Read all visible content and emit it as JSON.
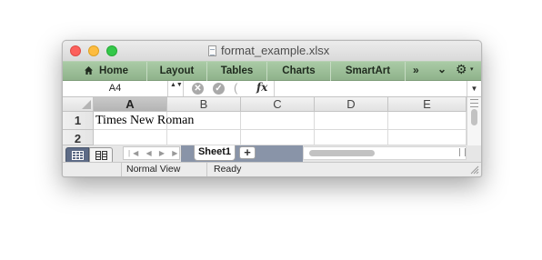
{
  "window": {
    "title": "format_example.xlsx"
  },
  "ribbon": {
    "tabs": [
      {
        "label": "Home",
        "icon": "home-icon"
      },
      {
        "label": "Layout"
      },
      {
        "label": "Tables"
      },
      {
        "label": "Charts"
      },
      {
        "label": "SmartArt"
      }
    ],
    "more_label": "»",
    "collapse_label": "⌄",
    "gear_label": "⚙",
    "gear_caret": "▾"
  },
  "formula_bar": {
    "name_box": "A4",
    "stepper": "▲▼",
    "cancel_icon": "✕",
    "accept_icon": "✓",
    "paren": "(",
    "fx_label": "fx",
    "formula_value": "",
    "dropdown_icon": "▼"
  },
  "sheet": {
    "columns": [
      "A",
      "B",
      "C",
      "D",
      "E"
    ],
    "selected_column": "A",
    "rows": [
      "1",
      "2"
    ],
    "cells": [
      [
        "Times New Roman",
        "",
        "",
        "",
        ""
      ],
      [
        "",
        "",
        "",
        "",
        ""
      ]
    ]
  },
  "sheet_bar": {
    "nav_arrows": "|◀ ◀ ▶ ▶|",
    "tabs": [
      "Sheet1"
    ],
    "add_label": "+"
  },
  "status_bar": {
    "view_label": "Normal View",
    "status_text": "Ready"
  },
  "colors": {
    "ribbon_green": "#9fc29b",
    "selected_header": "#bdbdbd",
    "sheet_strip": "#8994a8",
    "view_button_active": "#5d6b86"
  }
}
